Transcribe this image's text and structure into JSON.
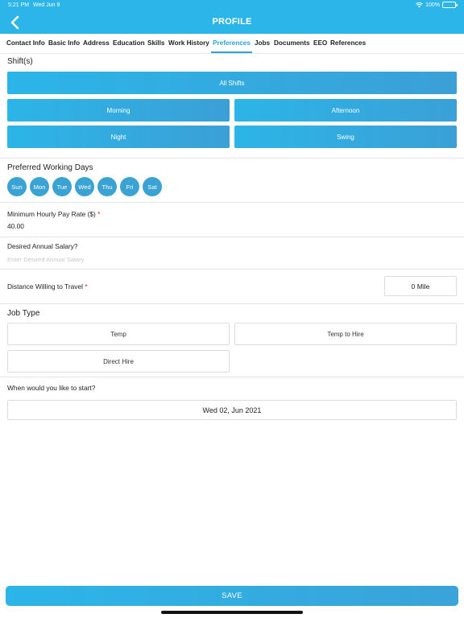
{
  "status_bar": {
    "time": "5:21 PM",
    "date": "Wed Jun 9",
    "battery": "100%"
  },
  "header": {
    "title": "PROFILE"
  },
  "tabs": [
    {
      "label": "Contact Info"
    },
    {
      "label": "Basic Info"
    },
    {
      "label": "Address"
    },
    {
      "label": "Education"
    },
    {
      "label": "Skills"
    },
    {
      "label": "Work History"
    },
    {
      "label": "Preferences",
      "active": true
    },
    {
      "label": "Jobs"
    },
    {
      "label": "Documents"
    },
    {
      "label": "EEO"
    },
    {
      "label": "References"
    }
  ],
  "shifts": {
    "title": "Shift(s)",
    "all": "All Shifts",
    "options": [
      "Morning",
      "Afternoon",
      "Night",
      "Swing"
    ]
  },
  "working_days": {
    "title": "Preferred Working Days",
    "days": [
      "Sun",
      "Mon",
      "Tue",
      "Wed",
      "Thu",
      "Fri",
      "Sat"
    ]
  },
  "pay_rate": {
    "label": "Minimum Hourly Pay Rate ($)",
    "required_mark": "*",
    "value": "40.00"
  },
  "salary": {
    "label": "Desired Annual Salary?",
    "placeholder": "Enter Desired Annual Salary"
  },
  "distance": {
    "label": "Distance Willing to Travel",
    "required_mark": "*",
    "value": "0 Mile"
  },
  "job_type": {
    "title": "Job Type",
    "options": [
      "Temp",
      "Temp to Hire",
      "Direct Hire"
    ]
  },
  "start": {
    "label": "When would you like to start?",
    "value": "Wed 02, Jun 2021"
  },
  "save_label": "SAVE",
  "colors": {
    "accent": "#2cb5e8",
    "active_tab": "#2ca3d8",
    "required": "#e02020"
  }
}
